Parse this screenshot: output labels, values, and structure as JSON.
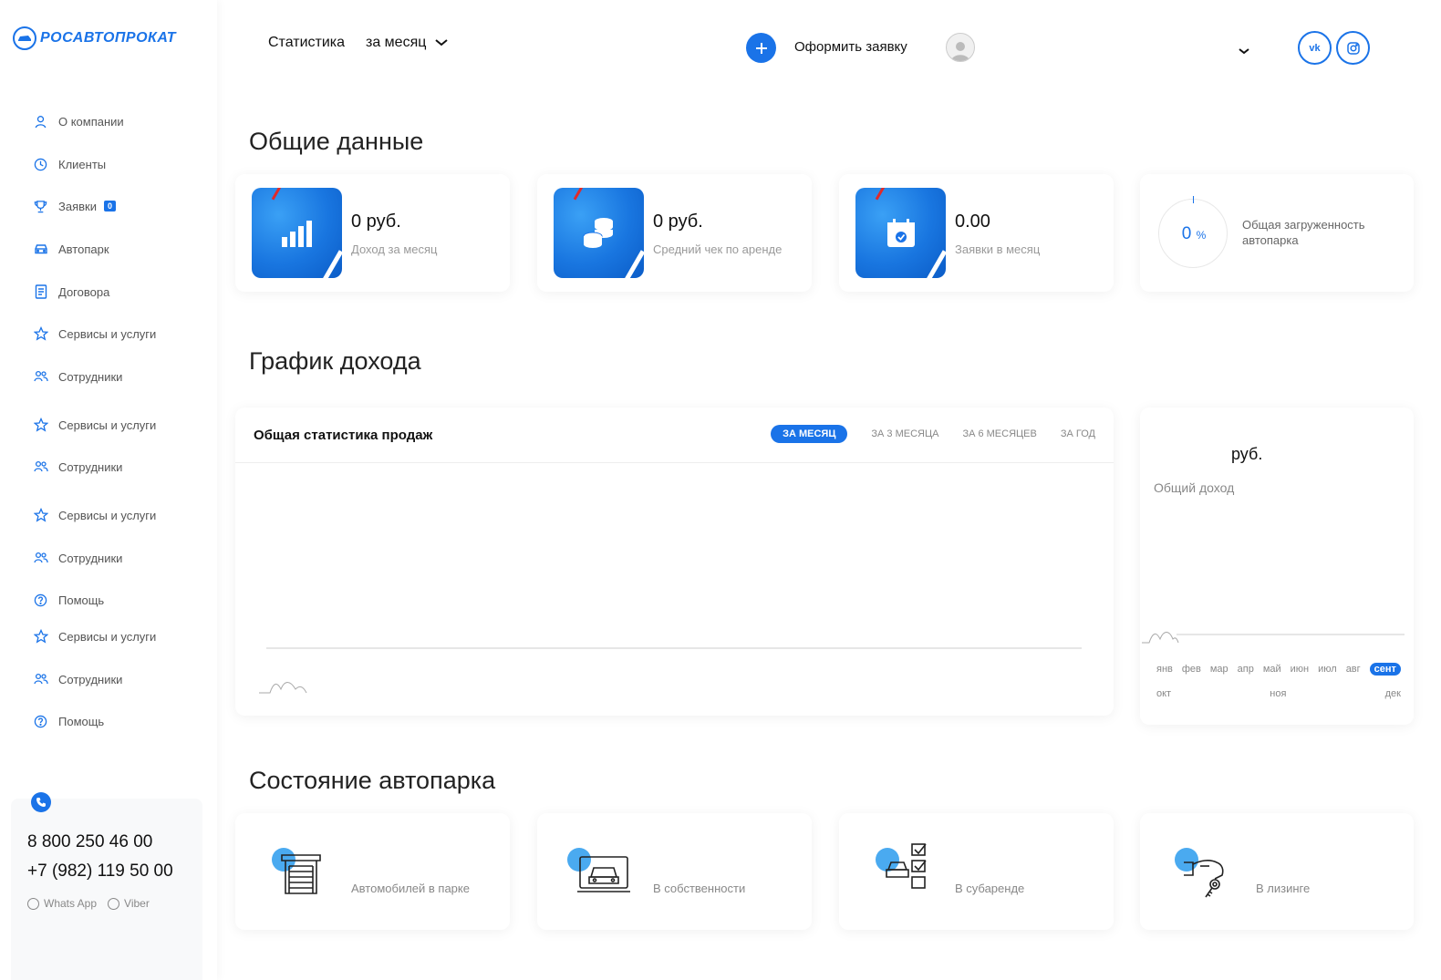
{
  "brand": {
    "name": "РОСАВТОПРОКАТ",
    "color": "#1a73e8"
  },
  "sidebar": {
    "items": [
      {
        "label": "О компании",
        "icon": "user-icon"
      },
      {
        "label": "Клиенты",
        "icon": "clock-icon"
      },
      {
        "label": "Заявки",
        "icon": "trophy-icon",
        "badge": "0"
      },
      {
        "label": "Автопарк",
        "icon": "car-icon"
      },
      {
        "label": "Договора",
        "icon": "document-icon"
      },
      {
        "label": "Сервисы и услуги",
        "icon": "star-icon"
      },
      {
        "label": "Сотрудники",
        "icon": "users-icon"
      },
      {
        "label": "Сервисы и услуги",
        "icon": "star-icon"
      },
      {
        "label": "Сотрудники",
        "icon": "users-icon"
      },
      {
        "label": "Сервисы и услуги",
        "icon": "star-icon"
      },
      {
        "label": "Сотрудники",
        "icon": "users-icon"
      },
      {
        "label": "Помощь",
        "icon": "help-icon"
      },
      {
        "label": "Сервисы и услуги",
        "icon": "star-icon"
      },
      {
        "label": "Сотрудники",
        "icon": "users-icon"
      },
      {
        "label": "Помощь",
        "icon": "help-icon"
      }
    ],
    "contacts": {
      "phone1": "8 800 250 46 00",
      "phone2": "+7 (982) 119 50 00",
      "whatsapp": "Whats App",
      "viber": "Viber"
    }
  },
  "header": {
    "title": "Статистика",
    "period": "за месяц",
    "add_label": "Оформить заявку",
    "social": [
      "vk",
      "instagram"
    ]
  },
  "overview": {
    "title": "Общие данные",
    "cards": [
      {
        "value": "0 руб.",
        "label": "Доход за месяц",
        "icon": "bar-chart-icon"
      },
      {
        "value": "0 руб.",
        "label": "Средний чек по аренде",
        "icon": "coins-icon"
      },
      {
        "value": "0.00",
        "label": "Заявки в месяц",
        "icon": "calendar-icon"
      }
    ],
    "load": {
      "value": "0",
      "unit": "%",
      "label": "Общая загруженность автопарка"
    }
  },
  "income": {
    "title": "График дохода",
    "sales_title": "Общая статистика продаж",
    "tabs": [
      "ЗА МЕСЯЦ",
      "ЗА 3 МЕСЯЦА",
      "ЗА 6 МЕСЯЦЕВ",
      "ЗА ГОД"
    ],
    "active_tab": 0,
    "total_value": "руб.",
    "total_label": "Общий доход",
    "months": [
      "янв",
      "фев",
      "мар",
      "апр",
      "май",
      "июн",
      "июл",
      "авг",
      "сент",
      "окт",
      "ноя",
      "дек"
    ],
    "active_month": 8
  },
  "fleet": {
    "title": "Состояние автопарка",
    "cards": [
      {
        "label": "Автомобилей в парке",
        "icon": "garage-icon"
      },
      {
        "label": "В собственности",
        "icon": "car-screen-icon"
      },
      {
        "label": "В субаренде",
        "icon": "checklist-icon"
      },
      {
        "label": "В лизинге",
        "icon": "hand-key-icon"
      }
    ]
  }
}
